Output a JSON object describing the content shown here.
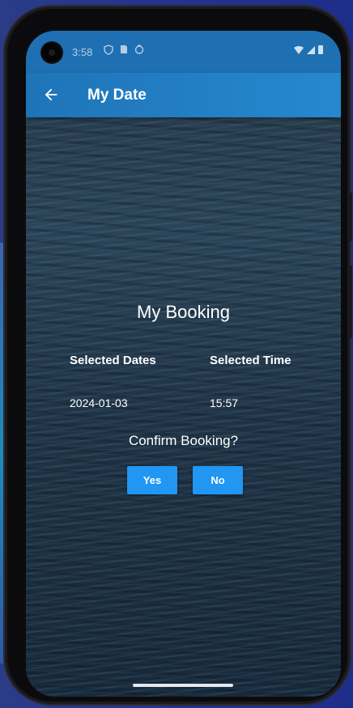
{
  "status_bar": {
    "time": "3:58",
    "left_icons": [
      "shield-icon",
      "sim-icon",
      "sync-icon"
    ],
    "right_icons": [
      "wifi-icon",
      "signal-icon",
      "battery-icon"
    ]
  },
  "app_bar": {
    "title": "My Date",
    "back_icon": "arrow-left-icon"
  },
  "booking": {
    "title": "My Booking",
    "dates_label": "Selected Dates",
    "time_label": "Selected Time",
    "date_value": "2024-01-03",
    "time_value": "15:57",
    "confirm_prompt": "Confirm Booking?",
    "yes_label": "Yes",
    "no_label": "No"
  },
  "colors": {
    "app_bar": "#2688cf",
    "button": "#2196f3",
    "text": "#ffffff"
  }
}
